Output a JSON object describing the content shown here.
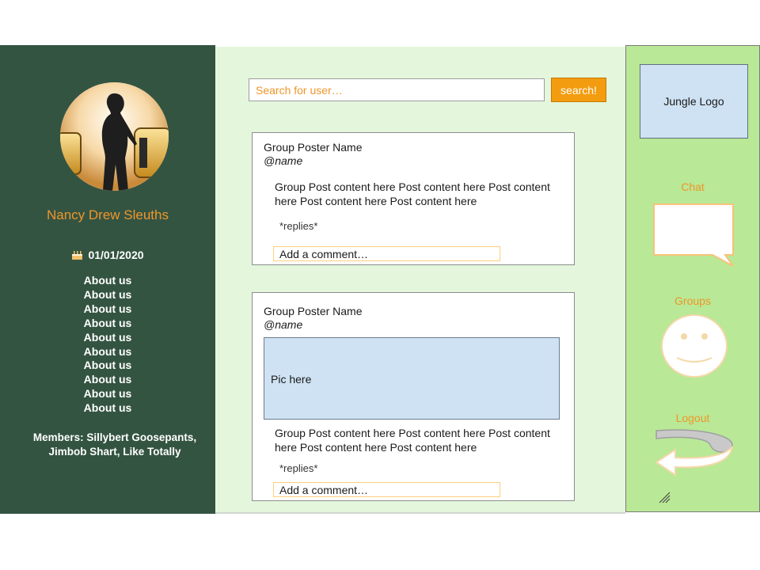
{
  "profile": {
    "group_name": "Nancy Drew Sleuths",
    "birthday": "01/01/2020",
    "about_links": [
      "About us",
      "About us",
      "About us",
      "About us",
      "About us",
      "About us",
      "About us",
      "About us",
      "About us",
      "About us"
    ],
    "members": "Members: Sillybert Goosepants, Jimbob Shart, Like Totally"
  },
  "search": {
    "placeholder": "Search for user…",
    "button_label": "search!"
  },
  "posts": [
    {
      "poster_name": "Group Poster Name",
      "handle": "@name",
      "content": "Group Post content here Post content here Post content here Post content here Post content here",
      "replies": "*replies*",
      "comment_placeholder": "Add a comment…"
    },
    {
      "poster_name": "Group Poster Name",
      "handle": "@name",
      "picture_label": "Pic here",
      "content": "Group Post content here Post content here Post content here Post content here Post content here",
      "replies": "*replies*",
      "comment_placeholder": "Add a comment…"
    }
  ],
  "nav": {
    "logo": "Jungle Logo",
    "chat_label": "Chat",
    "groups_label": "Groups",
    "logout_label": "Logout",
    "icons": {
      "chat": "speech-bubble-icon",
      "groups": "smiley-face-icon",
      "logout": "curved-back-arrow-icon",
      "resize": "resize-grip-icon"
    }
  },
  "colors": {
    "left_sidebar": "#345442",
    "main_background": "#e4f7dd",
    "right_sidebar": "#b9e896",
    "accent_orange": "#f49c10",
    "placeholder_blue": "#cfe2f3"
  }
}
